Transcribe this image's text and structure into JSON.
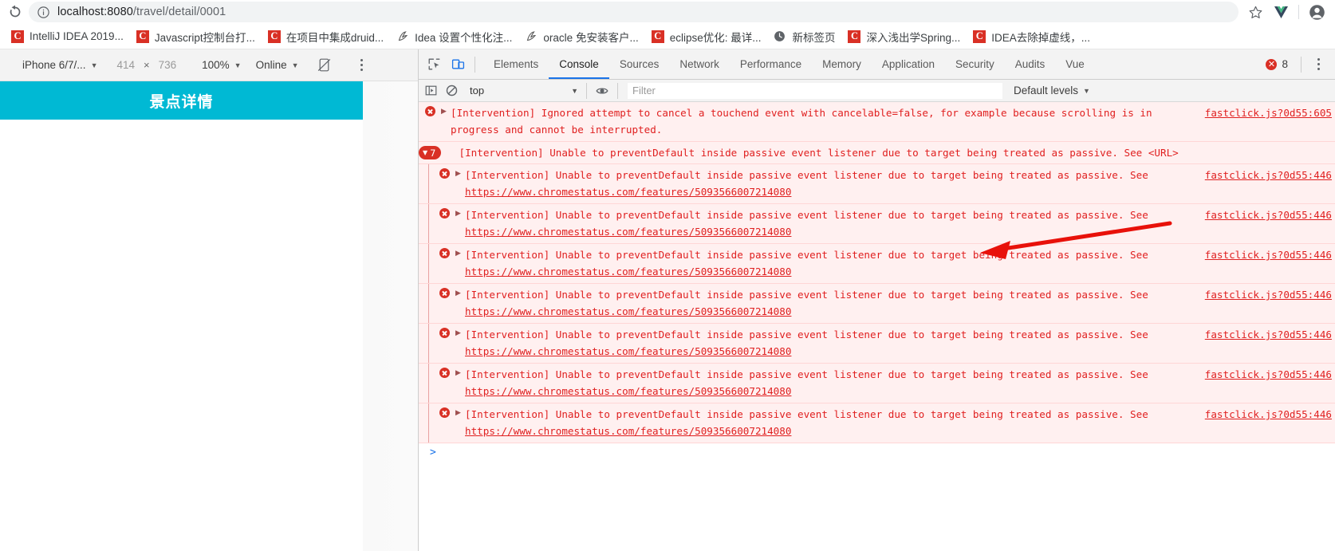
{
  "browser": {
    "url_host": "localhost:8080",
    "url_path": "/travel/detail/0001",
    "reload_icon": "reload-icon",
    "info_icon": "info-circle-icon",
    "star_icon": "bookmark-star-icon",
    "vue_icon": "vue-devtools-icon",
    "profile_icon": "profile-avatar-icon",
    "bookmarks": [
      {
        "label": "IntelliJ IDEA 2019...",
        "icon": "csdn-favicon"
      },
      {
        "label": "Javascript控制台打...",
        "icon": "csdn-favicon"
      },
      {
        "label": "在项目中集成druid...",
        "icon": "csdn-favicon"
      },
      {
        "label": "Idea 设置个性化注...",
        "icon": "jianshu-favicon"
      },
      {
        "label": "oracle 免安装客户...",
        "icon": "jianshu-favicon"
      },
      {
        "label": "eclipse优化: 最详...",
        "icon": "csdn-favicon"
      },
      {
        "label": "新标签页",
        "icon": "globe-favicon"
      },
      {
        "label": "深入浅出学Spring...",
        "icon": "csdn-favicon"
      },
      {
        "label": "IDEA去除掉虚线，...",
        "icon": "csdn-favicon"
      }
    ]
  },
  "device_toolbar": {
    "device": "iPhone 6/7/...",
    "width": "414",
    "times": "×",
    "height": "736",
    "zoom": "100%",
    "network": "Online",
    "rotate_icon": "rotate-device-icon",
    "more_icon": "more-vertical-icon"
  },
  "mobile_app": {
    "header_title": "景点详情"
  },
  "devtools": {
    "inspect_icon": "inspect-element-icon",
    "device_toggle_icon": "toggle-device-toolbar-icon",
    "tabs": [
      {
        "label": "Elements",
        "selected": false
      },
      {
        "label": "Console",
        "selected": true
      },
      {
        "label": "Sources",
        "selected": false
      },
      {
        "label": "Network",
        "selected": false
      },
      {
        "label": "Performance",
        "selected": false
      },
      {
        "label": "Memory",
        "selected": false
      },
      {
        "label": "Application",
        "selected": false
      },
      {
        "label": "Security",
        "selected": false
      },
      {
        "label": "Audits",
        "selected": false
      },
      {
        "label": "Vue",
        "selected": false
      }
    ],
    "error_count": "8",
    "more_icon": "more-vertical-icon"
  },
  "console_toolbar": {
    "sidebar_icon": "console-sidebar-icon",
    "clear_icon": "clear-console-icon",
    "context": "top",
    "eye_icon": "live-expression-eye-icon",
    "filter_value": "",
    "filter_placeholder": "Filter",
    "levels": "Default levels"
  },
  "console": {
    "messages": [
      {
        "kind": "error",
        "text": "[Intervention] Ignored attempt to cancel a touchend event with cancelable=false, for example because scrolling is in progress and cannot be interrupted.",
        "source": "fastclick.js?0d55:605",
        "indent": false
      }
    ],
    "group": {
      "count": "7",
      "triangle": "▼",
      "text": "[Intervention] Unable to preventDefault inside passive event listener due to target being treated as passive. See <URL>"
    },
    "repeated": {
      "count": 7,
      "prefix": "[Intervention] Unable to preventDefault inside passive event listener due to target being treated as passive. See ",
      "link": "https://www.chromestatus.com/features/5093566007214080",
      "source": "fastclick.js?0d55:446"
    },
    "prompt": ">"
  },
  "colors": {
    "app_header": "#00b9d4",
    "error_red": "#e02020",
    "error_bg": "#fff0f0",
    "accent_blue": "#1a73e8",
    "badge_red": "#d93025"
  }
}
